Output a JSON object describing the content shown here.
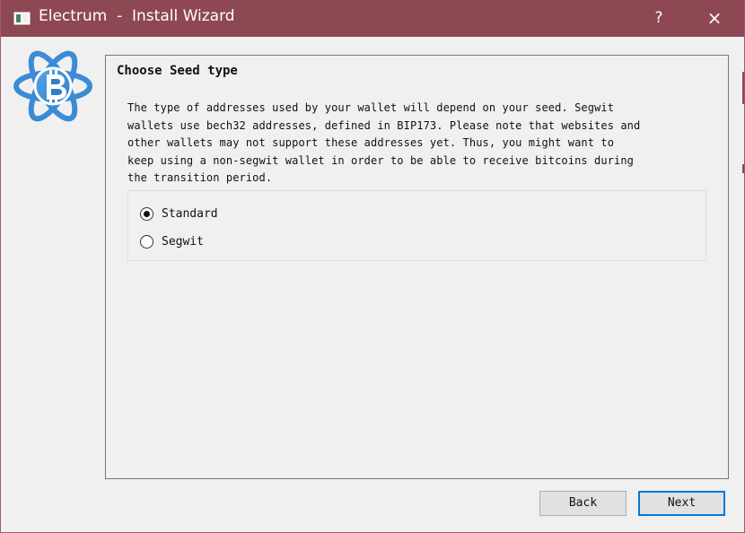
{
  "window": {
    "title": "Electrum  -  Install Wizard",
    "help_label": "?",
    "close_label": "×",
    "accent_color": "#8e4854",
    "title_icon": "app-window-icon",
    "logo_icon": "electrum-bitcoin-logo-icon"
  },
  "wizard": {
    "heading": "Choose Seed type",
    "description_lines": [
      "The type of addresses used by your wallet will depend on your seed. Segwit",
      "wallets use bech32 addresses, defined in BIP173. Please note that websites and",
      "other wallets may not support these addresses yet. Thus, you might want to",
      "keep using a non-segwit wallet in order to be able to receive bitcoins during",
      "the transition period."
    ],
    "options": [
      {
        "label": "Standard",
        "selected": true
      },
      {
        "label": "Segwit",
        "selected": false
      }
    ]
  },
  "buttons": {
    "back": "Back",
    "next": "Next",
    "focus_color": "#0078d7"
  }
}
